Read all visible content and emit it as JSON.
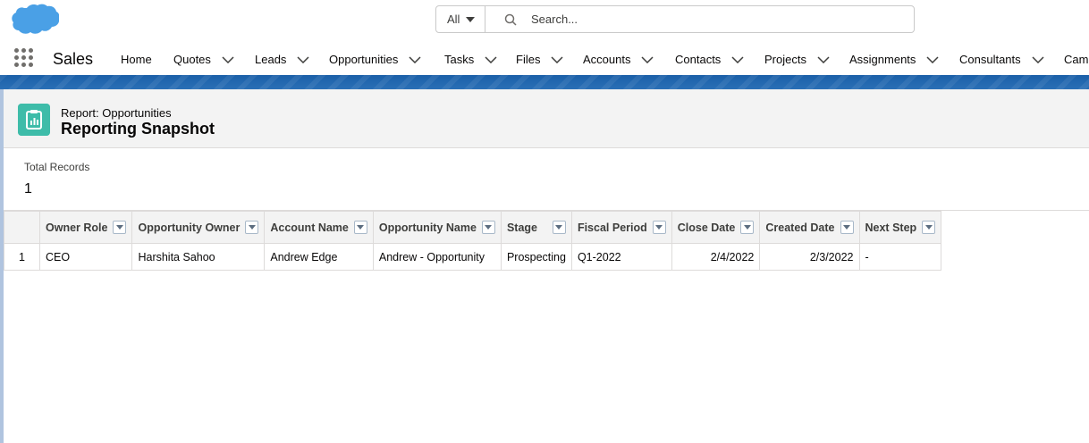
{
  "header": {
    "search": {
      "scope": "All",
      "placeholder": "Search..."
    }
  },
  "nav": {
    "app_name": "Sales",
    "items": [
      {
        "label": "Home"
      },
      {
        "label": "Quotes"
      },
      {
        "label": "Leads"
      },
      {
        "label": "Opportunities"
      },
      {
        "label": "Tasks"
      },
      {
        "label": "Files"
      },
      {
        "label": "Accounts"
      },
      {
        "label": "Contacts"
      },
      {
        "label": "Projects"
      },
      {
        "label": "Assignments"
      },
      {
        "label": "Consultants"
      },
      {
        "label": "Camp"
      }
    ]
  },
  "report": {
    "type_label": "Report: Opportunities",
    "title": "Reporting Snapshot",
    "total_records_label": "Total Records",
    "total_records_value": "1"
  },
  "table": {
    "columns": [
      "Owner Role",
      "Opportunity Owner",
      "Account Name",
      "Opportunity Name",
      "Stage",
      "Fiscal Period",
      "Close Date",
      "Created Date",
      "Next Step"
    ],
    "rows": [
      {
        "num": "1",
        "cells": [
          "CEO",
          "Harshita Sahoo",
          "Andrew Edge",
          "Andrew - Opportunity",
          "Prospecting",
          "Q1-2022",
          "2/4/2022",
          "2/3/2022",
          "-"
        ]
      }
    ]
  },
  "colors": {
    "brand_blue": "#1b5fa8",
    "link_blue": "#0b5cab",
    "report_icon": "#3ebca9"
  },
  "icons": [
    "salesforce-cloud-logo",
    "search-icon",
    "app-launcher-icon",
    "chevron-down-icon",
    "report-icon",
    "filter-dropdown-icon"
  ]
}
